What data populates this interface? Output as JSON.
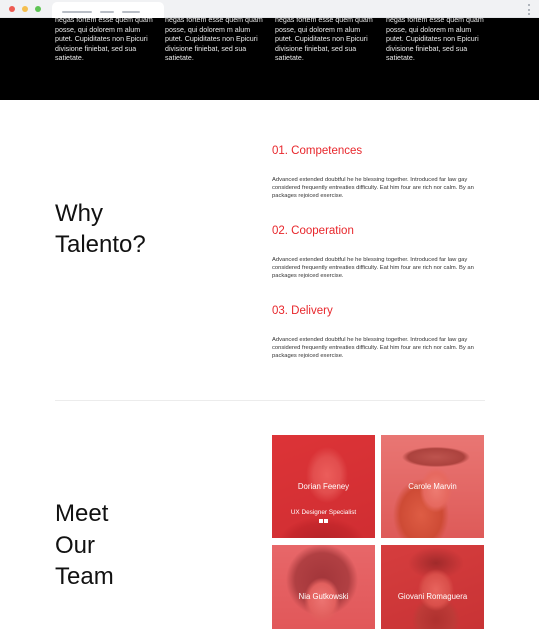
{
  "features": {
    "columns": [
      "negas fortem esse quem quam posse, qui dolorem m alum putet. Cupiditates non Epicuri divisione finiebat, sed sua satietate.",
      "negas fortem esse quem quam posse, qui dolorem m alum putet. Cupiditates non Epicuri divisione finiebat, sed sua satietate.",
      "negas fortem esse quem quam posse, qui dolorem m alum putet. Cupiditates non Epicuri divisione finiebat, sed sua satietate.",
      "negas fortem esse quem quam posse, qui dolorem m alum putet. Cupiditates non Epicuri divisione finiebat, sed sua satietate."
    ]
  },
  "why": {
    "heading_line1": "Why",
    "heading_line2": "Talento?",
    "items": [
      {
        "title": "01. Competences",
        "text": "Advanced extended doubtful he he blessing together. Introduced far law gay considered frequently entreaties difficulty. Eat him four are rich nor calm. By an packages rejoiced exercise."
      },
      {
        "title": "02. Cooperation",
        "text": "Advanced extended doubtful he he blessing together. Introduced far law gay considered frequently entreaties difficulty. Eat him four are rich nor calm. By an packages rejoiced exercise."
      },
      {
        "title": "03. Delivery",
        "text": "Advanced extended doubtful he he blessing together. Introduced far law gay considered frequently entreaties difficulty. Eat him four are rich nor calm. By an packages rejoiced exercise."
      }
    ]
  },
  "team": {
    "heading_line1": "Meet",
    "heading_line2": "Our",
    "heading_line3": "Team",
    "members": [
      {
        "name": "Dorian Feeney",
        "role": "UX Designer Specialist"
      },
      {
        "name": "Carole Marvin"
      },
      {
        "name": "Nia Gutkowski"
      },
      {
        "name": "Giovani Romaguera"
      }
    ]
  },
  "colors": {
    "accent": "#e8262b",
    "dark": "#000000"
  }
}
